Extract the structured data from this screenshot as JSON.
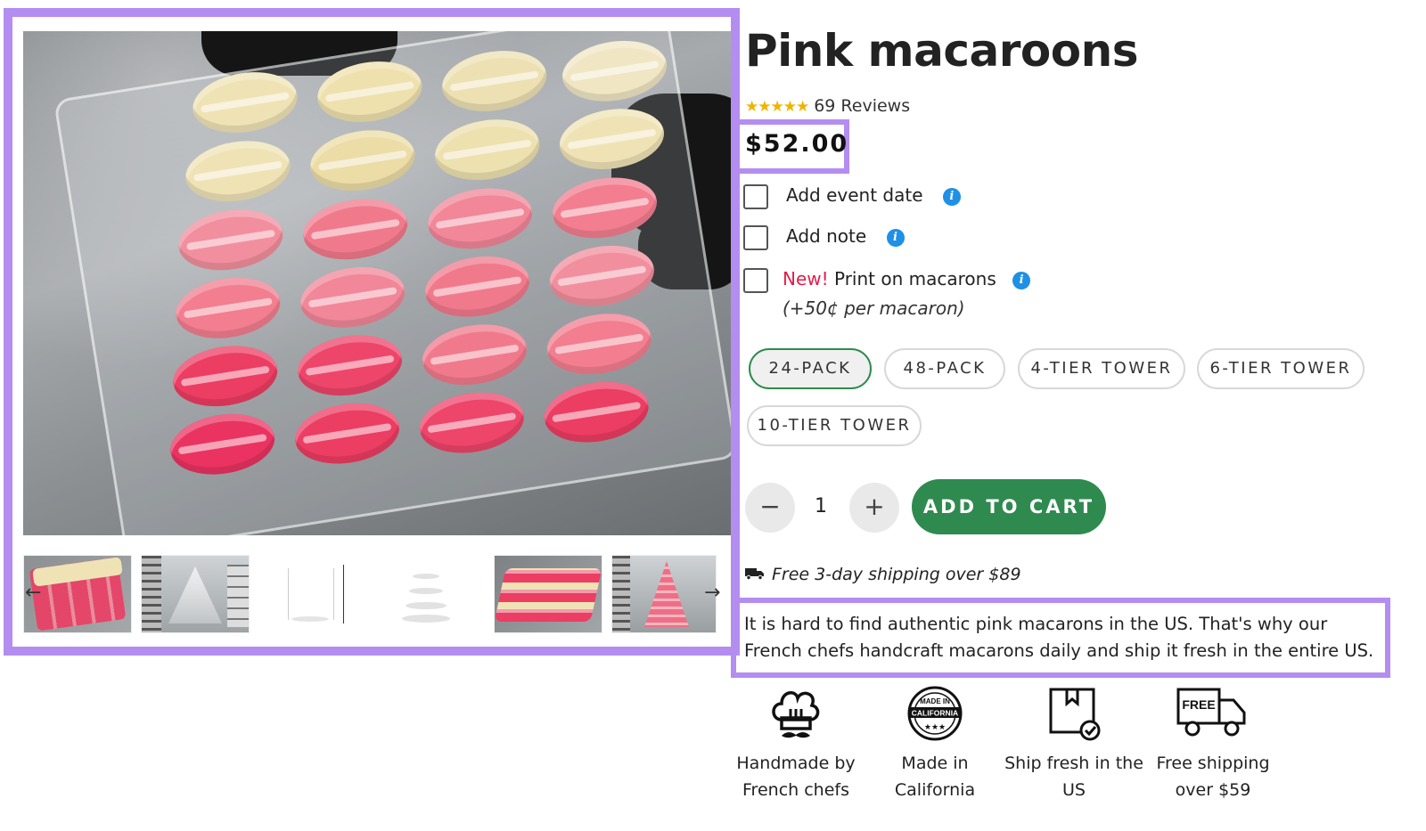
{
  "product": {
    "title": "Pink macaroons",
    "review_count": "69 Reviews",
    "stars": "★★★★★",
    "price": "$52.00"
  },
  "options": [
    {
      "label": "Add event date"
    },
    {
      "label": "Add note"
    },
    {
      "new_tag": "New!",
      "label": "Print on macarons",
      "note": "(+50¢ per macaron)"
    }
  ],
  "packs": [
    "24-PACK",
    "48-PACK",
    "4-TIER TOWER",
    "6-TIER TOWER",
    "10-TIER TOWER"
  ],
  "selected_pack": "24-PACK",
  "quantity": {
    "value": "1",
    "minus": "−",
    "plus": "+"
  },
  "cart": {
    "label": "ADD TO CART"
  },
  "shipping": {
    "text": "Free 3-day shipping over $89"
  },
  "description": "It is hard to find authentic pink macarons in the US. That's why our French chefs handcraft macarons daily and ship it fresh in the entire US.",
  "features": [
    {
      "icon": "chef-hat-icon",
      "label": "Handmade by French chefs"
    },
    {
      "icon": "made-in-california-badge-icon",
      "label": "Made in California"
    },
    {
      "icon": "box-check-icon",
      "label": "Ship fresh in the US"
    },
    {
      "icon": "free-shipping-truck-icon",
      "label": "Free shipping over $59"
    }
  ],
  "badge_text": {
    "made": "MADE IN",
    "state": "CALIFORNIA",
    "free": "FREE"
  },
  "info_glyph": "i",
  "colors": {
    "highlight": "#b48df0",
    "cart_green": "#2f8a4f",
    "selected_border": "#2e8a4e",
    "info_blue": "#1e90e6",
    "new_red": "#e31c4c",
    "star_gold": "#f0b400"
  }
}
